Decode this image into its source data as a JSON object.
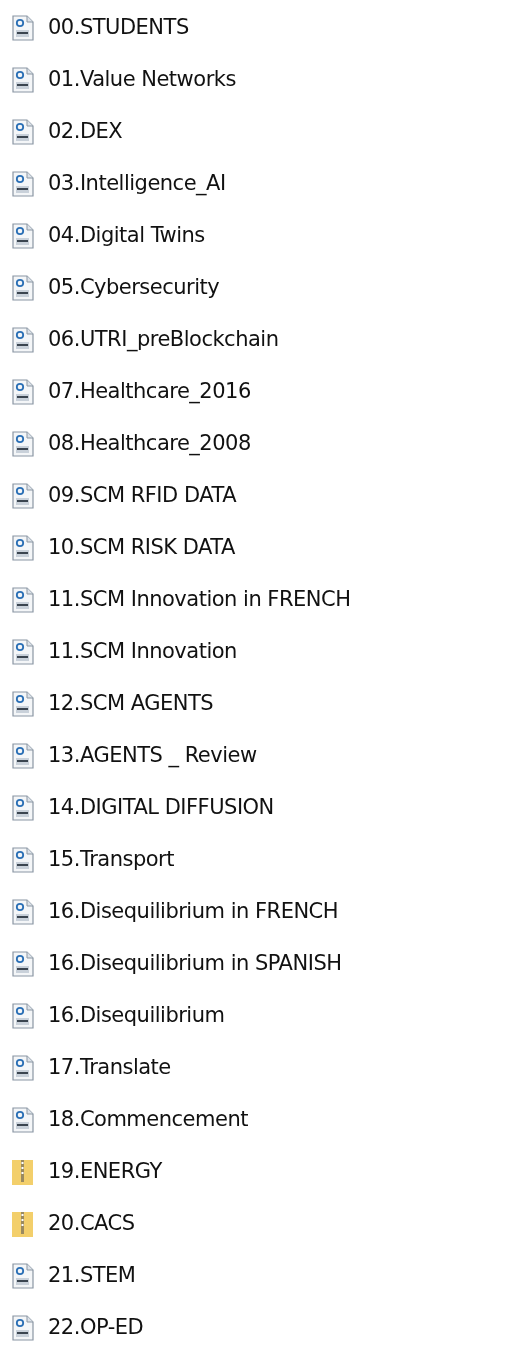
{
  "files": [
    {
      "name": "00.STUDENTS",
      "kind": "pdf"
    },
    {
      "name": "01.Value Networks",
      "kind": "pdf"
    },
    {
      "name": "02.DEX",
      "kind": "pdf"
    },
    {
      "name": "03.Intelligence_AI",
      "kind": "pdf"
    },
    {
      "name": "04.Digital Twins",
      "kind": "pdf"
    },
    {
      "name": "05.Cybersecurity",
      "kind": "pdf"
    },
    {
      "name": "06.UTRI_preBlockchain",
      "kind": "pdf"
    },
    {
      "name": "07.Healthcare_2016",
      "kind": "pdf"
    },
    {
      "name": "08.Healthcare_2008",
      "kind": "pdf"
    },
    {
      "name": "09.SCM RFID DATA",
      "kind": "pdf"
    },
    {
      "name": "10.SCM RISK DATA",
      "kind": "pdf"
    },
    {
      "name": "11.SCM Innovation in FRENCH",
      "kind": "pdf"
    },
    {
      "name": "11.SCM Innovation",
      "kind": "pdf"
    },
    {
      "name": "12.SCM AGENTS",
      "kind": "pdf"
    },
    {
      "name": "13.AGENTS _ Review",
      "kind": "pdf"
    },
    {
      "name": "14.DIGITAL DIFFUSION",
      "kind": "pdf"
    },
    {
      "name": "15.Transport",
      "kind": "pdf"
    },
    {
      "name": "16.Disequilibrium in FRENCH",
      "kind": "pdf"
    },
    {
      "name": "16.Disequilibrium in SPANISH",
      "kind": "pdf"
    },
    {
      "name": "16.Disequilibrium",
      "kind": "pdf"
    },
    {
      "name": "17.Translate",
      "kind": "pdf"
    },
    {
      "name": "18.Commencement",
      "kind": "pdf"
    },
    {
      "name": "19.ENERGY",
      "kind": "zip"
    },
    {
      "name": "20.CACS",
      "kind": "zip"
    },
    {
      "name": "21.STEM",
      "kind": "pdf"
    },
    {
      "name": "22.OP-ED",
      "kind": "pdf"
    }
  ]
}
